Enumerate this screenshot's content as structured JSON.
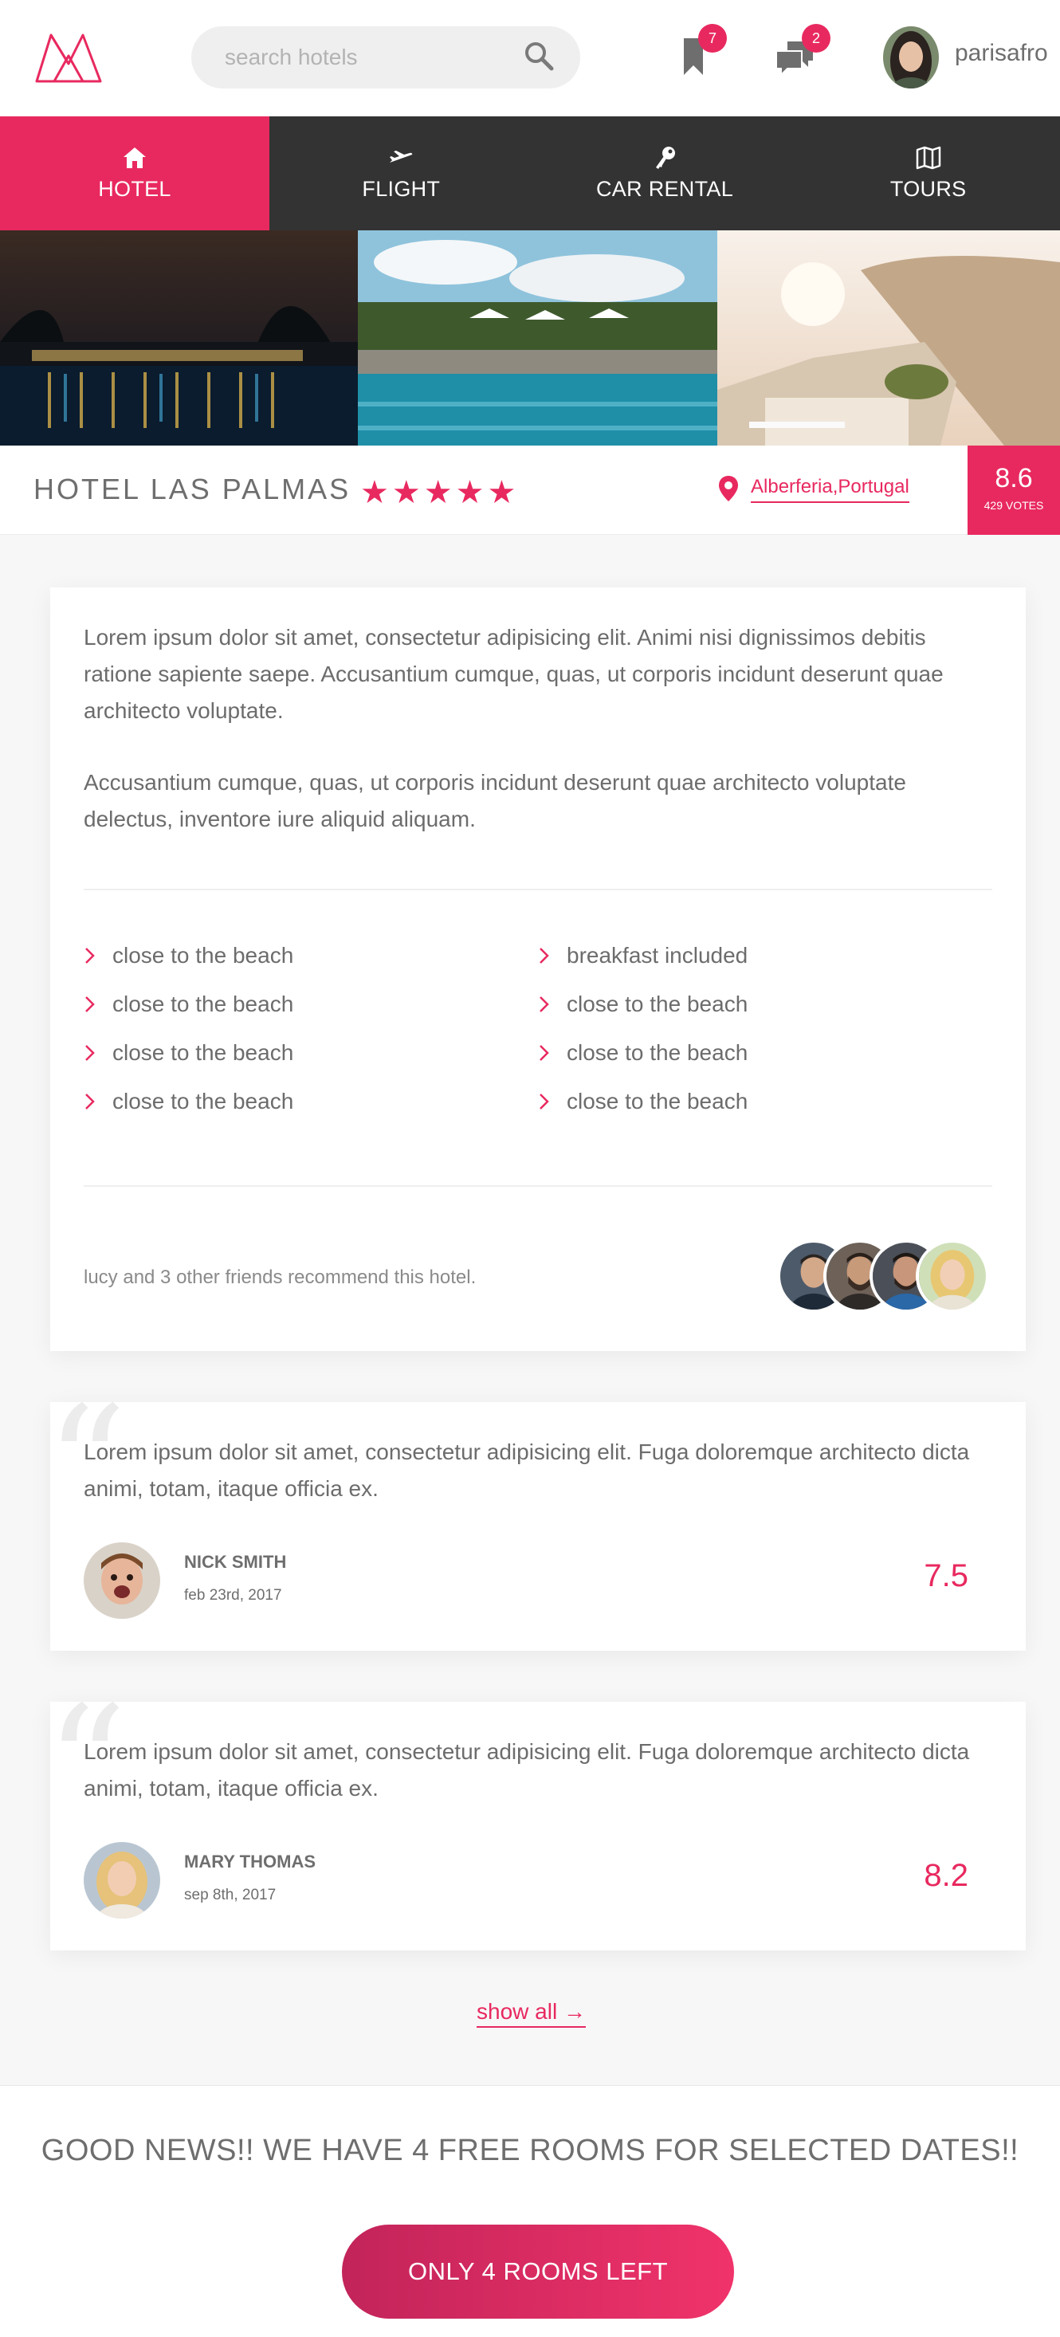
{
  "header": {
    "search_placeholder": "search hotels",
    "bookmarks_count": "7",
    "messages_count": "2",
    "username": "parisafro"
  },
  "nav": {
    "items": [
      {
        "label": "HOTEL",
        "icon": "home-icon",
        "active": true
      },
      {
        "label": "FLIGHT",
        "icon": "plane-icon",
        "active": false
      },
      {
        "label": "CAR RENTAL",
        "icon": "key-icon",
        "active": false
      },
      {
        "label": "TOURS",
        "icon": "map-icon",
        "active": false
      }
    ]
  },
  "hotel": {
    "name": "HOTEL LAS PALMAS",
    "stars": "★★★★★",
    "location": "Alberferia,Portugal",
    "score": "8.6",
    "votes": "429 VOTES"
  },
  "description": {
    "paragraphs": [
      "Lorem ipsum dolor sit amet, consectetur adipisicing elit. Animi nisi dignissimos debitis ratione sapiente saepe. Accusantium cumque, quas, ut corporis incidunt deserunt quae architecto voluptate.",
      "Accusantium cumque, quas, ut corporis incidunt deserunt quae architecto voluptate delectus, inventore iure aliquid aliquam."
    ],
    "features_left": [
      "close to the beach",
      "close to the beach",
      "close to the beach",
      "close to the beach"
    ],
    "features_right": [
      "breakfast included",
      "close to the beach",
      "close to the beach",
      "close to the beach"
    ],
    "recommend_text": "lucy and 3 other friends recommend this hotel."
  },
  "reviews": [
    {
      "text": "Lorem ipsum dolor sit amet, consectetur adipisicing elit. Fuga doloremque architecto dicta animi, totam, itaque officia ex.",
      "name": "NICK SMITH",
      "date": "feb 23rd, 2017",
      "score": "7.5"
    },
    {
      "text": "Lorem ipsum dolor sit amet, consectetur adipisicing elit. Fuga doloremque architecto dicta animi, totam, itaque officia ex.",
      "name": "MARY THOMAS",
      "date": "sep 8th, 2017",
      "score": "8.2"
    }
  ],
  "show_all": "show all  →",
  "good_news": {
    "text": "GOOD NEWS!! WE HAVE 4 FREE ROOMS FOR SELECTED DATES!!",
    "cta": "ONLY 4 ROOMS LEFT"
  },
  "colors": {
    "accent": "#e8295f",
    "nav_bg": "#333333",
    "text": "#6c6c6c"
  }
}
